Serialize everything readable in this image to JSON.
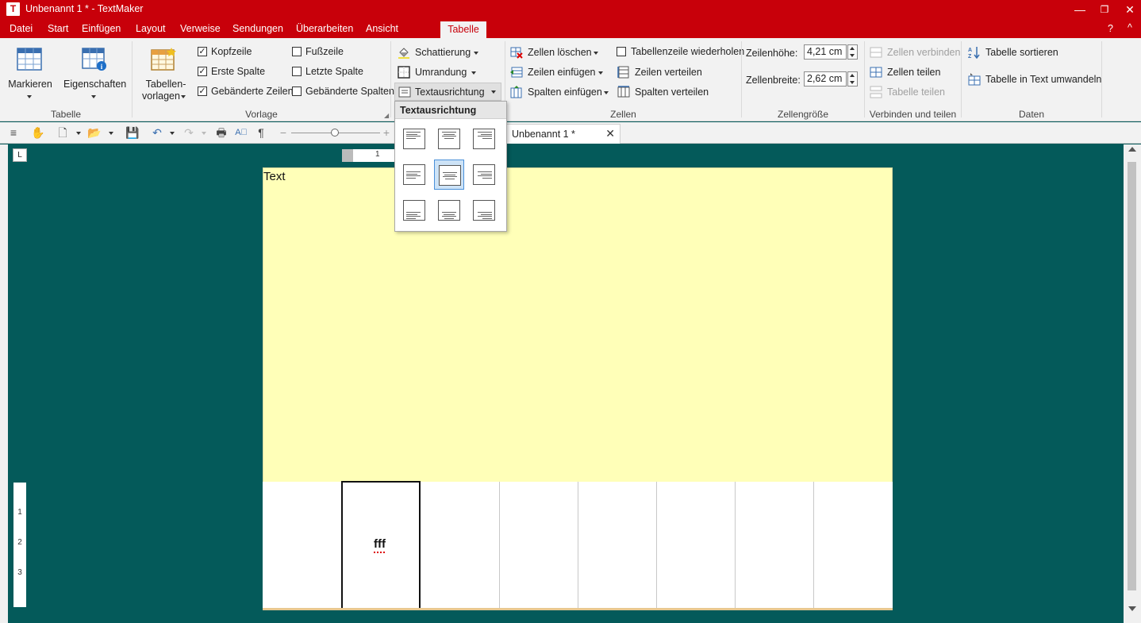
{
  "window": {
    "app_icon_letter": "T",
    "title": "Unbenannt 1 * - TextMaker",
    "min": "—",
    "restore": "❐",
    "close": "✕"
  },
  "menu": {
    "items": [
      "Datei",
      "Start",
      "Einfügen",
      "Layout",
      "Verweise",
      "Sendungen",
      "Überarbeiten",
      "Ansicht"
    ],
    "active_tab": "Tabelle",
    "help": "?",
    "collapse": "^"
  },
  "ribbon": {
    "tabelle_group": {
      "label": "Tabelle",
      "markieren": "Markieren",
      "eigenschaften": "Eigenschaften"
    },
    "vorlage_group": {
      "label": "Vorlage",
      "tabellenvorlagen_line1": "Tabellen-",
      "tabellenvorlagen_line2": "vorlagen",
      "checks": [
        {
          "label": "Kopfzeile",
          "checked": true
        },
        {
          "label": "Erste Spalte",
          "checked": true
        },
        {
          "label": "Gebänderte Zeilen",
          "checked": true
        },
        {
          "label": "Fußzeile",
          "checked": false
        },
        {
          "label": "Letzte Spalte",
          "checked": false
        },
        {
          "label": "Gebänderte Spalten",
          "checked": false
        }
      ]
    },
    "format_group": {
      "schattierung": "Schattierung",
      "umrandung": "Umrandung",
      "textausrichtung": "Textausrichtung"
    },
    "zellen_group": {
      "label": "Zellen",
      "zellen_loeschen": "Zellen löschen",
      "zeilen_einfuegen": "Zeilen einfügen",
      "spalten_einfuegen": "Spalten einfügen",
      "tabellenzeile_wiederholen": "Tabellenzeile wiederholen",
      "tabellenzeile_checked": false,
      "zeilen_verteilen": "Zeilen verteilen",
      "spalten_verteilen": "Spalten verteilen"
    },
    "groesse_group": {
      "label": "Zellengröße",
      "zeilenhoehe_label": "Zeilenhöhe:",
      "zeilenhoehe_value": "4,21 cm",
      "zellenbreite_label": "Zellenbreite:",
      "zellenbreite_value": "2,62 cm"
    },
    "verbinden_group": {
      "label": "Verbinden und teilen",
      "zellen_verbinden": "Zellen verbinden",
      "zellen_teilen": "Zellen teilen",
      "tabelle_teilen": "Tabelle teilen"
    },
    "daten_group": {
      "label": "Daten",
      "tabelle_sortieren": "Tabelle sortieren",
      "tabelle_in_text": "Tabelle in Text umwandeln"
    }
  },
  "popup": {
    "title": "Textausrichtung",
    "selected_index": 4
  },
  "document": {
    "tab_label": "Unbenannt 1 *",
    "tab_close": "✕",
    "cell_text_top": "Text",
    "cell_text_selected": "fff",
    "ruler_top_mark": "1",
    "ruler_left_marks": [
      "1",
      "2",
      "3"
    ],
    "corner_glyph": "L"
  },
  "colors": {
    "brand_red": "#c8000a",
    "workspace": "#045a5a",
    "row_highlight": "#ffffb8",
    "selection_blue": "#cde3f7"
  }
}
